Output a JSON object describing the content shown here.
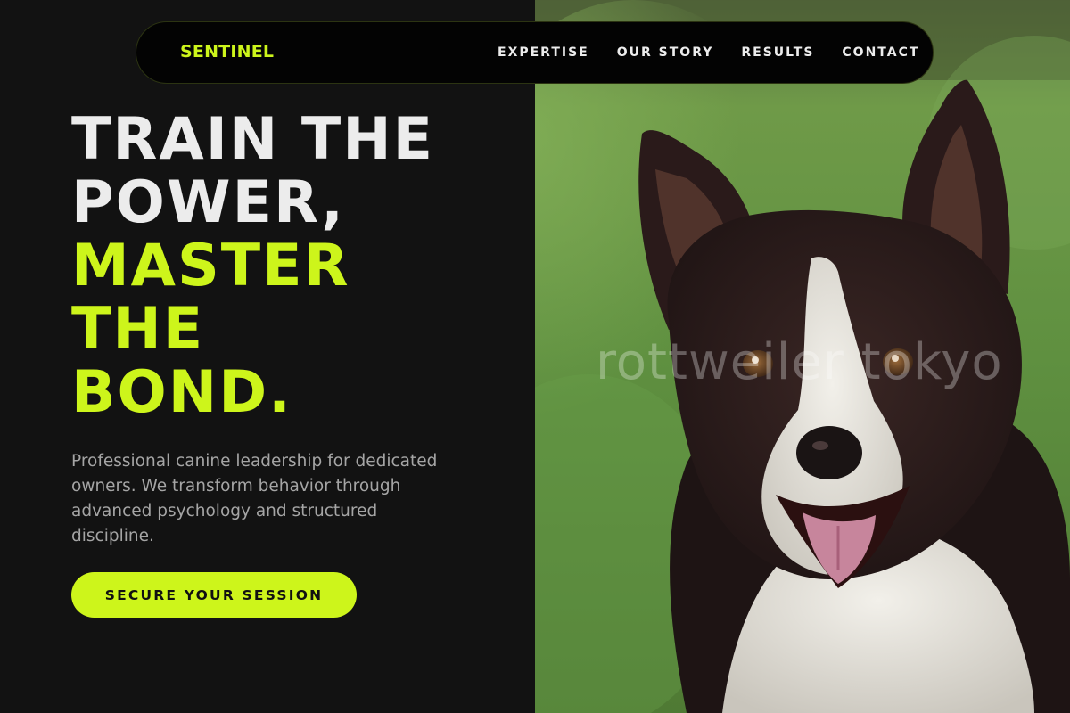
{
  "nav": {
    "brand": "SENTINEL",
    "links": [
      {
        "label": "EXPERTISE"
      },
      {
        "label": "OUR STORY"
      },
      {
        "label": "RESULTS"
      },
      {
        "label": "CONTACT"
      }
    ]
  },
  "hero": {
    "headline_lines": [
      "TRAIN THE",
      "POWER,"
    ],
    "headline_accent_lines": [
      "MASTER",
      "THE",
      "BOND."
    ],
    "description": "Professional canine leadership for dedicated owners. We transform behavior through advanced psychology and structured discipline.",
    "cta_label": "SECURE YOUR SESSION"
  },
  "image": {
    "watermark": "rottweiler tokyo",
    "subject": "border-collie-photo"
  },
  "colors": {
    "accent": "#cdf51b",
    "background": "#121212",
    "nav_background": "#030303",
    "heading_text": "#ececec",
    "body_text": "#a5a5a5"
  }
}
